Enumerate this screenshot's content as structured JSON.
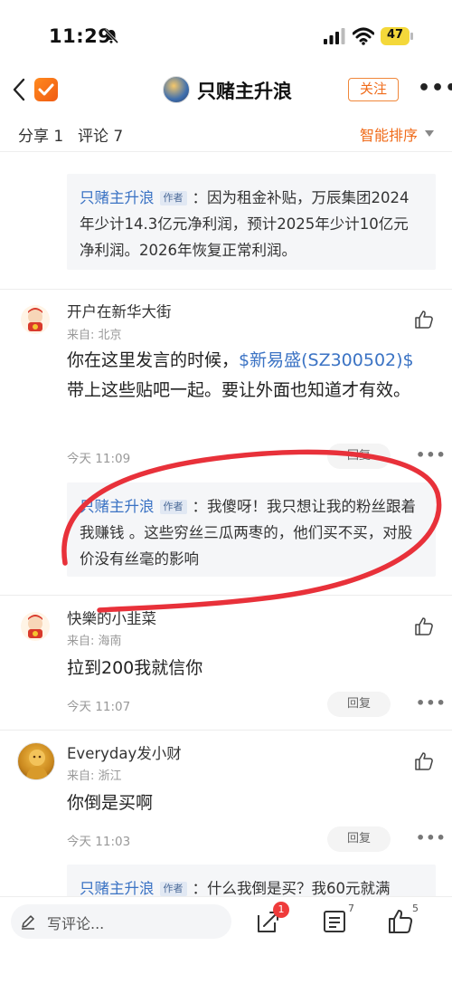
{
  "status": {
    "time": "11:29",
    "battery": "47"
  },
  "header": {
    "title": "只赌主升浪",
    "follow": "关注"
  },
  "tabs": {
    "share": "分享 1",
    "comments": "评论 7",
    "sort": "智能排序"
  },
  "quote1": {
    "author": "只赌主升浪",
    "tag": "作者",
    "text": "：因为租金补贴，万辰集团2024年少计14.3亿元净利润，预计2025年少计10亿元净利润。2026年恢复正常利润。"
  },
  "comment1": {
    "name": "开户在新华大街",
    "from": "来自: 北京",
    "text_before": "你在这里发言的时候，",
    "link": "$新易盛(SZ300502)$",
    "text_after": " 带上这些贴吧一起。要让外面也知道才有效。",
    "time": "今天 11:09",
    "reply": "回复",
    "quote": {
      "author": "只赌主升浪",
      "tag": "作者",
      "text": "：我傻呀！我只想让我的粉丝跟着我赚钱 。这些穷丝三瓜两枣的，他们买不买，对股价没有丝毫的影响"
    }
  },
  "comment2": {
    "name": "快樂的小韭菜",
    "from": "来自: 海南",
    "text": "拉到200我就信你",
    "time": "今天 11:07",
    "reply": "回复"
  },
  "comment3": {
    "name": "Everyday发小财",
    "from": "来自: 浙江",
    "text": "你倒是买啊",
    "time": "今天 11:03",
    "reply": "回复",
    "quote": {
      "author": "只赌主升浪",
      "tag": "作者",
      "text": "：什么我倒是买？我60元就满"
    }
  },
  "bottom": {
    "placeholder": "写评论...",
    "share_badge": "1",
    "comment_count": "7",
    "like_count": "5"
  },
  "colors": {
    "accent": "#f06b1a",
    "link": "#3b73c4",
    "annotation": "#e8313a"
  }
}
